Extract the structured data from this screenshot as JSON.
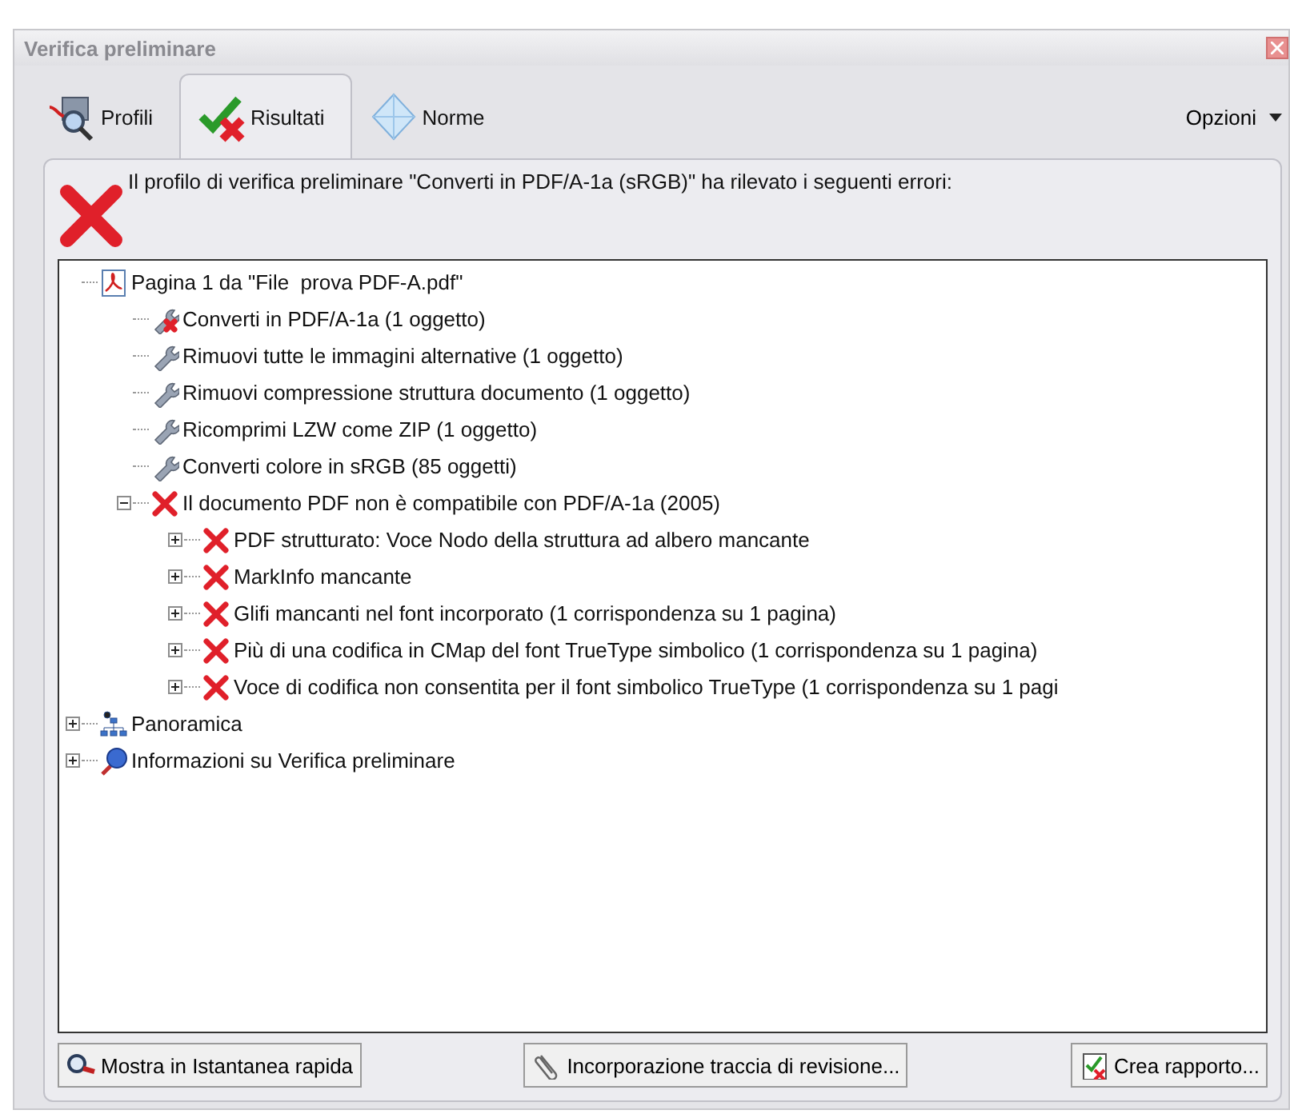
{
  "window": {
    "title": "Verifica preliminare"
  },
  "tabs": [
    {
      "label": "Profili",
      "selected": false
    },
    {
      "label": "Risultati",
      "selected": true
    },
    {
      "label": "Norme",
      "selected": false
    }
  ],
  "options_menu": {
    "label": "Opzioni"
  },
  "message": {
    "text": "Il profilo di verifica preliminare \"Converti in PDF/A-1a (sRGB)\" ha rilevato i seguenti errori:"
  },
  "tree": [
    {
      "kind": "pdf",
      "label": "Pagina 1 da \"File  prova PDF-A.pdf\"",
      "children": [
        {
          "kind": "fix-failed",
          "label": "Converti in PDF/A-1a (1 oggetto)"
        },
        {
          "kind": "fix",
          "label": "Rimuovi tutte le immagini alternative (1 oggetto)"
        },
        {
          "kind": "fix",
          "label": "Rimuovi compressione struttura documento (1 oggetto)"
        },
        {
          "kind": "fix",
          "label": "Ricomprimi LZW come ZIP (1 oggetto)"
        },
        {
          "kind": "fix",
          "label": "Converti colore in sRGB (85 oggetti)"
        },
        {
          "kind": "error",
          "label": "Il documento PDF non è compatibile con PDF/A-1a (2005)",
          "expanded": true,
          "children": [
            {
              "kind": "error",
              "label": "PDF strutturato: Voce Nodo della struttura ad albero mancante",
              "expanded": false
            },
            {
              "kind": "error",
              "label": "MarkInfo mancante",
              "expanded": false
            },
            {
              "kind": "error",
              "label": "Glifi mancanti nel font incorporato (1 corrispondenza su 1 pagina)",
              "expanded": false
            },
            {
              "kind": "error",
              "label": "Più di una codifica in CMap del font TrueType simbolico (1 corrispondenza su 1 pagina)",
              "expanded": false
            },
            {
              "kind": "error",
              "label": "Voce di codifica non consentita per il font simbolico TrueType (1 corrispondenza su 1 pagi",
              "expanded": false
            }
          ]
        }
      ]
    },
    {
      "kind": "overview",
      "label": "Panoramica",
      "expanded": false
    },
    {
      "kind": "info",
      "label": "Informazioni su Verifica preliminare",
      "expanded": false
    }
  ],
  "buttons": [
    {
      "label": "Mostra in Istantanea rapida"
    },
    {
      "label": "Incorporazione traccia di revisione..."
    },
    {
      "label": "Crea rapporto..."
    }
  ]
}
